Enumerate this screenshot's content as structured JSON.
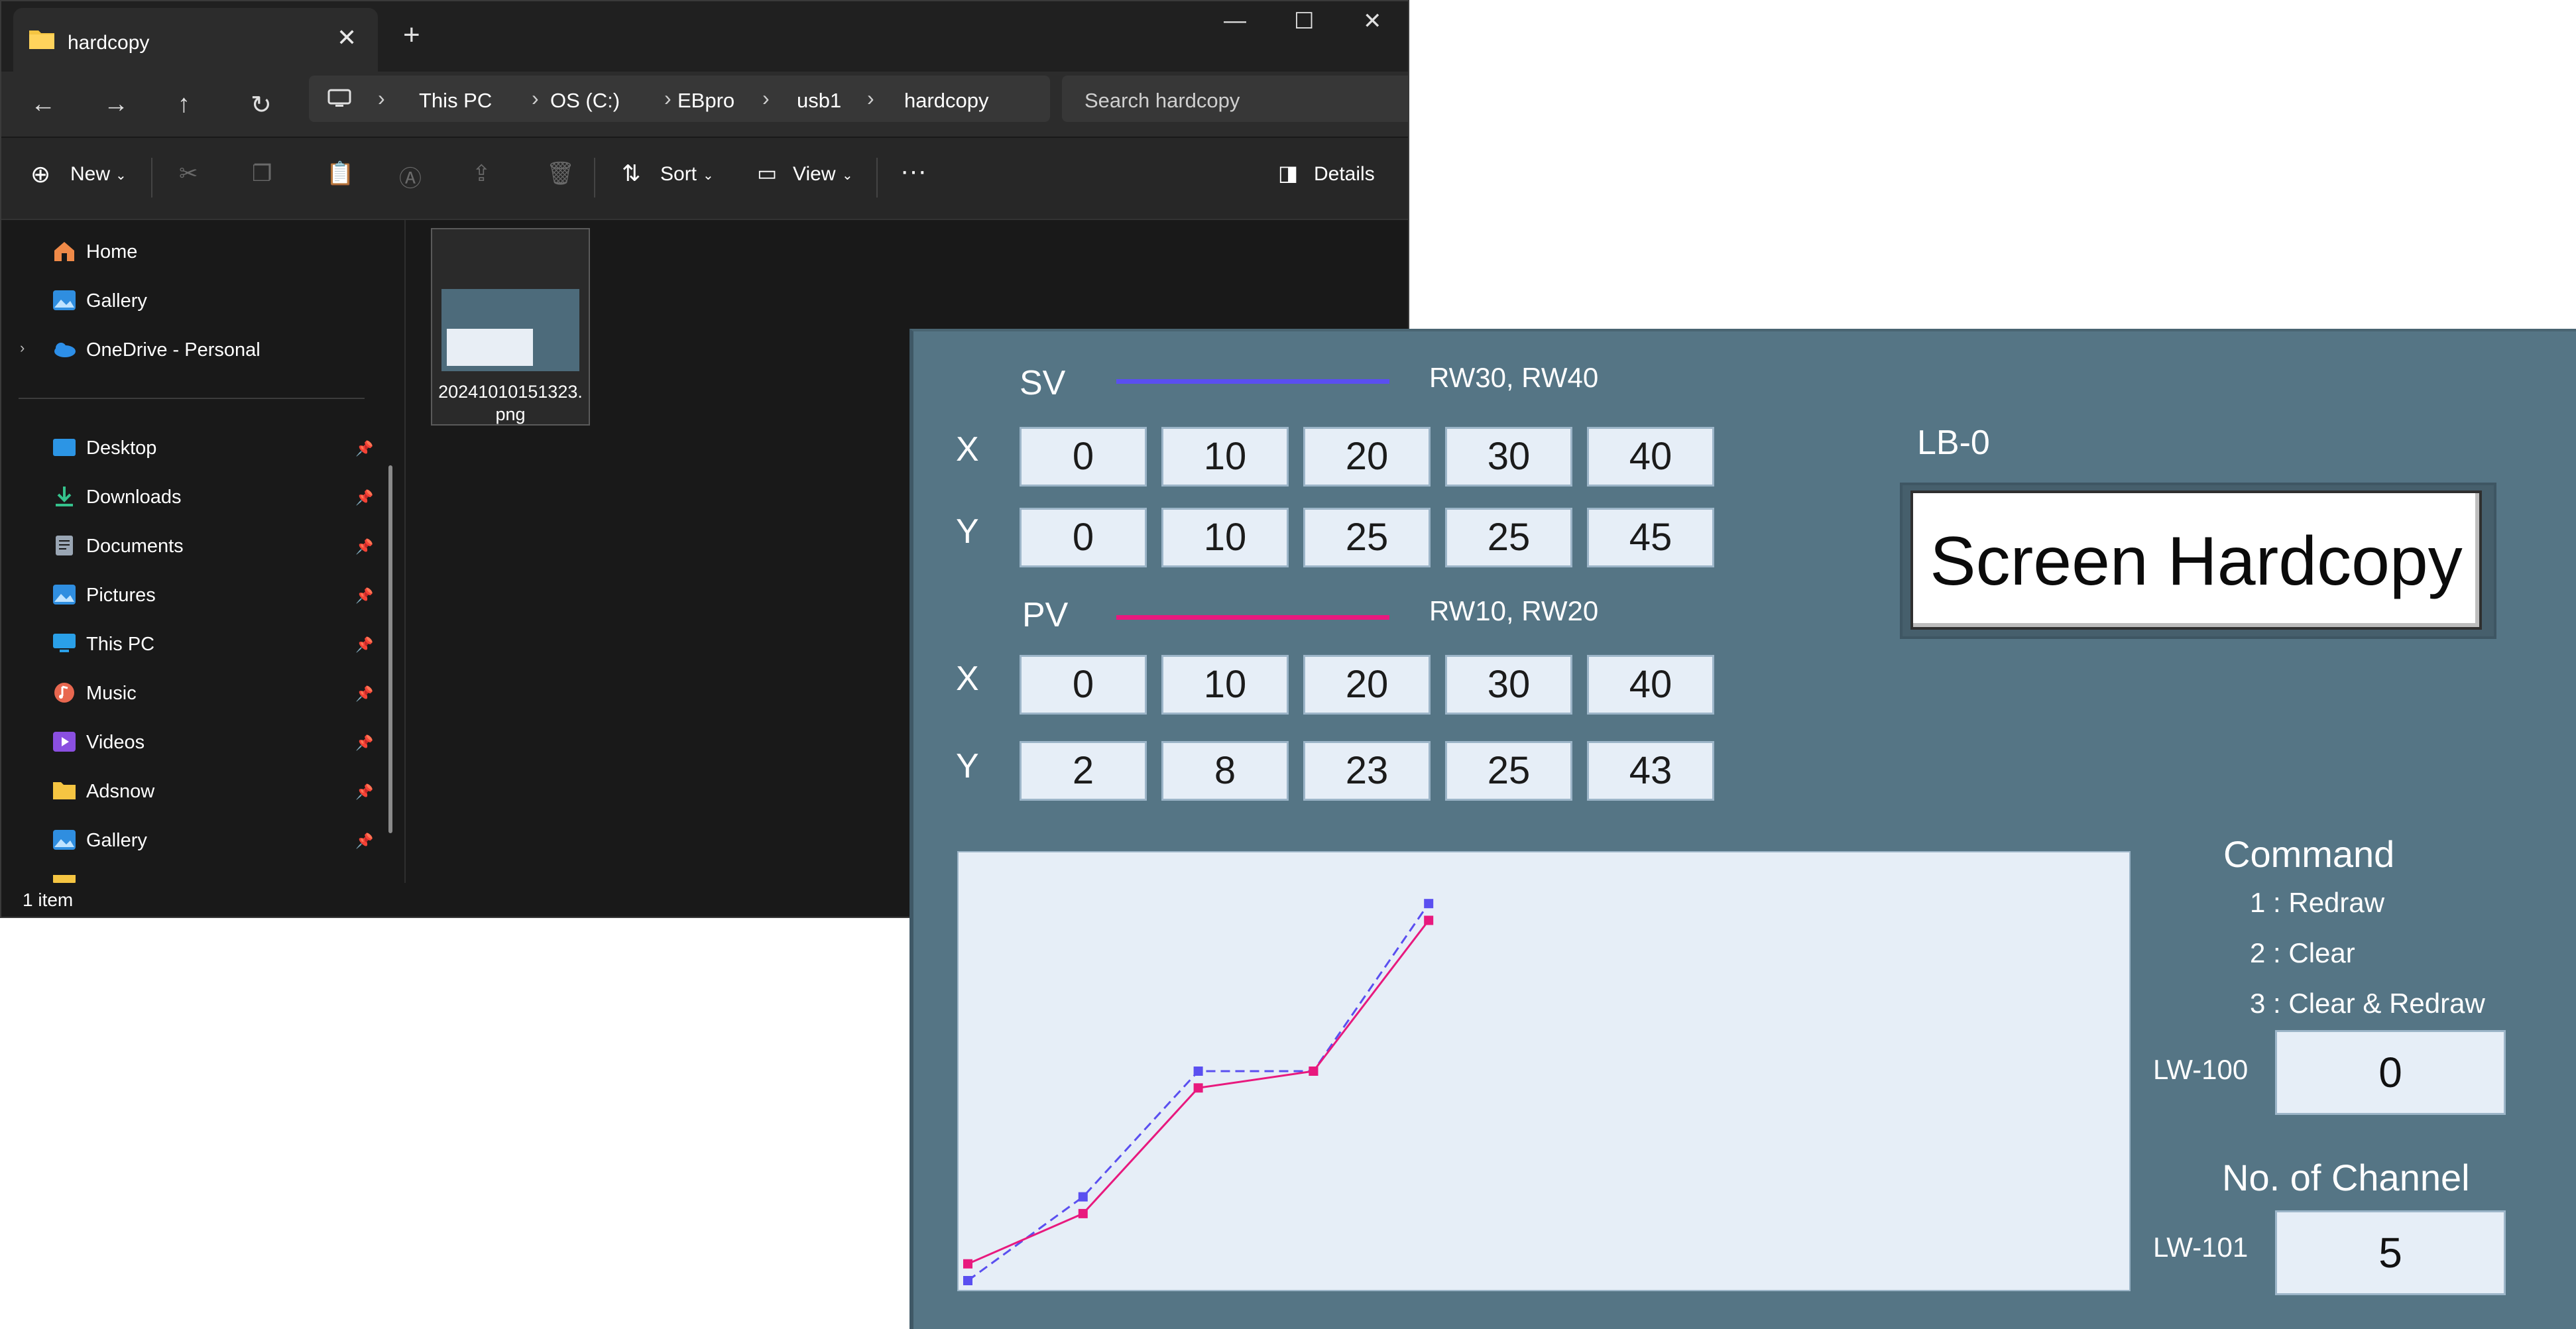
{
  "explorer": {
    "tab_title": "hardcopy",
    "tab_close": "✕",
    "new_tab": "+",
    "window_controls": {
      "minimize": "—",
      "maximize": "☐",
      "close": "✕"
    },
    "nav": {
      "back": "←",
      "forward": "→",
      "up": "↑",
      "refresh": "↻"
    },
    "breadcrumb": [
      "This PC",
      "OS (C:)",
      "EBpro",
      "usb1",
      "hardcopy"
    ],
    "breadcrumb_sep": "›",
    "search_placeholder": "Search hardcopy",
    "toolbar": {
      "new_label": "New",
      "sort_label": "Sort",
      "view_label": "View",
      "more_label": "···",
      "details_label": "Details"
    },
    "sidebar": {
      "top_items": [
        {
          "label": "Home",
          "icon": "home-icon"
        },
        {
          "label": "Gallery",
          "icon": "gallery-icon"
        },
        {
          "label": "OneDrive - Personal",
          "icon": "cloud-icon"
        }
      ],
      "pinned_items": [
        {
          "label": "Desktop",
          "icon": "desktop-icon"
        },
        {
          "label": "Downloads",
          "icon": "download-icon"
        },
        {
          "label": "Documents",
          "icon": "documents-icon"
        },
        {
          "label": "Pictures",
          "icon": "pictures-icon"
        },
        {
          "label": "This PC",
          "icon": "computer-icon"
        },
        {
          "label": "Music",
          "icon": "music-icon"
        },
        {
          "label": "Videos",
          "icon": "videos-icon"
        },
        {
          "label": "Adsnow",
          "icon": "folder-icon"
        },
        {
          "label": "Gallery",
          "icon": "gallery-icon"
        }
      ],
      "pin_glyph": "📌"
    },
    "files": [
      {
        "name_line1": "20241010151323.",
        "name_line2": "png"
      }
    ],
    "status": {
      "item_count": "1 item"
    }
  },
  "hmi": {
    "sv": {
      "label": "SV",
      "registers": "RW30, RW40",
      "line_color": "#5a4ff0",
      "x_label": "X",
      "y_label": "Y",
      "x": [
        0,
        10,
        20,
        30,
        40
      ],
      "y": [
        0,
        10,
        25,
        25,
        45
      ]
    },
    "pv": {
      "label": "PV",
      "registers": "RW10, RW20",
      "line_color": "#e8197e",
      "x_label": "X",
      "y_label": "Y",
      "x": [
        0,
        10,
        20,
        30,
        40
      ],
      "y": [
        2,
        8,
        23,
        25,
        43
      ]
    },
    "lb_label": "LB-0",
    "hardcopy_button": "Screen Hardcopy",
    "command": {
      "title": "Command",
      "items": [
        "1 : Redraw",
        "2 : Clear",
        "3 : Clear & Redraw"
      ],
      "lw_label": "LW-100",
      "lw_value": "0"
    },
    "channel": {
      "title": "No. of Channel",
      "lw_label": "LW-101",
      "lw_value": "5"
    }
  },
  "chart_data": {
    "type": "line",
    "series": [
      {
        "name": "SV",
        "x": [
          0,
          10,
          20,
          30,
          40
        ],
        "y": [
          0,
          10,
          25,
          25,
          45
        ],
        "color": "#5a4ff0",
        "style": "dashed"
      },
      {
        "name": "PV",
        "x": [
          0,
          10,
          20,
          30,
          40
        ],
        "y": [
          2,
          8,
          23,
          25,
          43
        ],
        "color": "#e8197e",
        "style": "solid"
      }
    ],
    "xlim": [
      0,
      100
    ],
    "ylim": [
      0,
      50
    ],
    "grid": false
  }
}
